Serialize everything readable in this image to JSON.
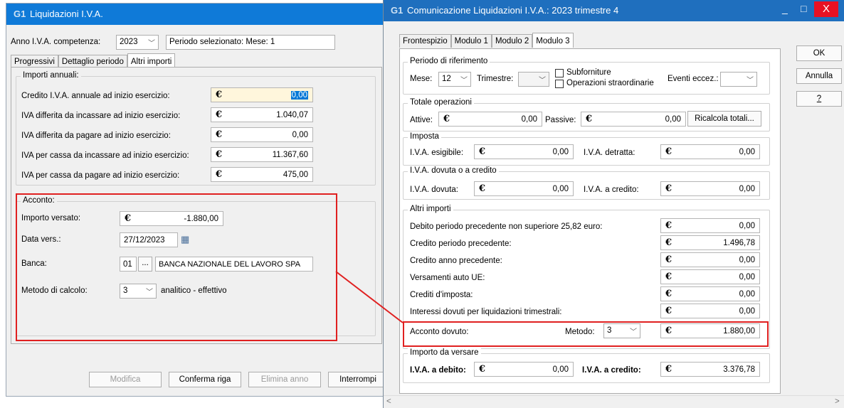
{
  "win1": {
    "title": "Liquidazioni I.V.A.",
    "anno_label": "Anno I.V.A. competenza:",
    "anno_value": "2023",
    "periodo": "Periodo selezionato: Mese: 1",
    "tabs": [
      "Progressivi",
      "Dettaglio periodo",
      "Altri importi"
    ],
    "annual": {
      "title": "Importi annuali:",
      "rows": [
        {
          "label": "Credito I.V.A. annuale ad inizio esercizio:",
          "value": "0,00"
        },
        {
          "label": "IVA differita da incassare ad inizio esercizio:",
          "value": "1.040,07"
        },
        {
          "label": "IVA differita da pagare ad inizio esercizio:",
          "value": "0,00"
        },
        {
          "label": "IVA per cassa da incassare ad inizio esercizio:",
          "value": "11.367,60"
        },
        {
          "label": "IVA per cassa da pagare ad inizio esercizio:",
          "value": "475,00"
        }
      ]
    },
    "acconto": {
      "title": "Acconto:",
      "importo_label": "Importo versato:",
      "importo": "-1.880,00",
      "data_label": "Data vers.:",
      "data": "27/12/2023",
      "banca_label": "Banca:",
      "banca_code": "01",
      "banca_btn": "...",
      "banca_name": "BANCA NAZIONALE DEL LAVORO SPA",
      "metodo_label": "Metodo di calcolo:",
      "metodo": "3",
      "metodo_desc": "analitico - effettivo"
    },
    "buttons": {
      "modifica": "Modifica",
      "conferma": "Conferma riga",
      "elimina": "Elimina anno",
      "interrompi": "Interrompi"
    }
  },
  "currency": "€",
  "win2": {
    "title": "Comunicazione Liquidazioni I.V.A.: 2023 trimestre 4",
    "min": "_",
    "max": "□",
    "close": "X",
    "tabs": [
      "Frontespizio",
      "Modulo 1",
      "Modulo 2",
      "Modulo 3"
    ],
    "ok": "OK",
    "annulla": "Annulla",
    "help": "?",
    "periodo": {
      "title": "Periodo di riferimento",
      "mese_label": "Mese:",
      "mese": "12",
      "trim_label": "Trimestre:",
      "subforniture": "Subforniture",
      "op_straord": "Operazioni straordinarie",
      "eventi_label": "Eventi eccez.:"
    },
    "totale": {
      "title": "Totale operazioni",
      "attive_label": "Attive:",
      "attive": "0,00",
      "passive_label": "Passive:",
      "passive": "0,00",
      "ricalcola": "Ricalcola totali..."
    },
    "imposta": {
      "title": "Imposta",
      "esig_label": "I.V.A. esigibile:",
      "esig": "0,00",
      "detr_label": "I.V.A. detratta:",
      "detr": "0,00"
    },
    "dovuta": {
      "title": "I.V.A. dovuta o a credito",
      "dov_label": "I.V.A. dovuta:",
      "dov": "0,00",
      "cred_label": "I.V.A. a credito:",
      "cred": "0,00"
    },
    "altri": {
      "title": "Altri importi",
      "rows": [
        {
          "label": "Debito periodo precedente non superiore 25,82 euro:",
          "value": "0,00"
        },
        {
          "label": "Credito periodo precedente:",
          "value": "1.496,78"
        },
        {
          "label": "Credito anno precedente:",
          "value": "0,00"
        },
        {
          "label": "Versamenti auto UE:",
          "value": "0,00"
        },
        {
          "label": "Crediti d'imposta:",
          "value": "0,00"
        },
        {
          "label": "Interessi dovuti per liquidazioni trimestrali:",
          "value": "0,00"
        }
      ],
      "acconto_label": "Acconto dovuto:",
      "metodo_label": "Metodo:",
      "metodo": "3",
      "acconto": "1.880,00"
    },
    "versare": {
      "title": "Importo da versare",
      "debito_label": "I.V.A. a debito:",
      "debito": "0,00",
      "credito_label": "I.V.A. a credito:",
      "credito": "3.376,78"
    },
    "scroll_left": "<",
    "scroll_right": ">"
  }
}
